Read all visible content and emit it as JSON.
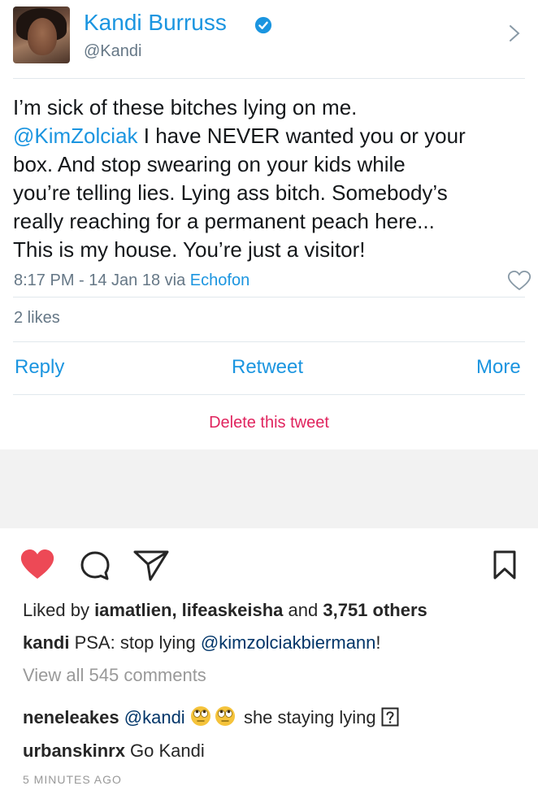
{
  "tweet": {
    "display_name": "Kandi Burruss",
    "handle": "@Kandi",
    "text_lines": [
      "I’m sick of these bitches lying on me.",
      " I have NEVER wanted you or your",
      "box. And stop swearing on your kids while",
      "you’re telling lies. Lying ass bitch. Somebody’s",
      "really reaching for a permanent peach here...",
      "This is my house. You’re just a visitor!"
    ],
    "mention": "@KimZolciak",
    "time_date": "8:17 PM - 14 Jan 18 via ",
    "via_app": "Echofon",
    "likes": "2 likes",
    "actions": {
      "reply": "Reply",
      "retweet": "Retweet",
      "more": "More"
    },
    "delete_label": "Delete this tweet",
    "colors": {
      "link_blue": "#1b95e0",
      "delete_red": "#e0245e",
      "meta_gray": "#657786"
    },
    "icons": [
      "verified-badge-icon",
      "chevron-right-icon",
      "heart-outline-icon"
    ]
  },
  "instagram": {
    "likes_line": {
      "prefix": "Liked by ",
      "user1": "iamatlien",
      "sep": ", ",
      "user2": "lifeaskeisha",
      "and": " and ",
      "others": "3,751 others"
    },
    "caption": {
      "user": "kandi",
      "text": " PSA: stop lying ",
      "mention": "@kimzolciakbiermann",
      "suffix": "!"
    },
    "view_all": "View all 545 comments",
    "comments": [
      {
        "user": "neneleakes",
        "mention": "@kandi",
        "text": " she staying lying "
      },
      {
        "user": "urbanskinrx",
        "text": " Go Kandi"
      }
    ],
    "timestamp_partial": "5 MINUTES AGO",
    "colors": {
      "heart_red": "#ed4956",
      "mention_blue": "#003569",
      "muted": "#999999"
    },
    "icons": [
      "heart-filled-icon",
      "comment-icon",
      "share-icon",
      "bookmark-icon",
      "rolling-eyes-emoji",
      "unknown-glyph-box"
    ]
  }
}
